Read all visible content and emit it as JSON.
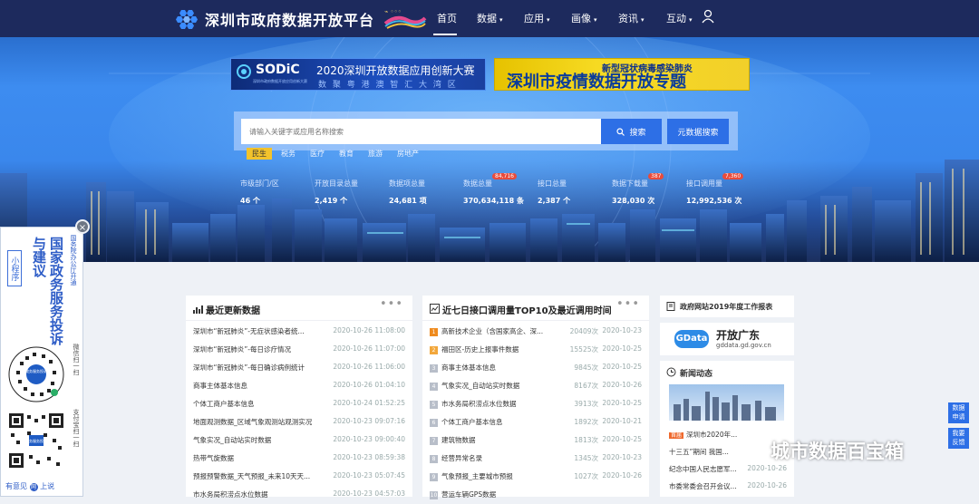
{
  "nav": {
    "site_title": "深圳市政府数据开放平台",
    "items": [
      {
        "label": "首页",
        "dropdown": false
      },
      {
        "label": "数据",
        "dropdown": true
      },
      {
        "label": "应用",
        "dropdown": true
      },
      {
        "label": "画像",
        "dropdown": true
      },
      {
        "label": "资讯",
        "dropdown": true
      },
      {
        "label": "互动",
        "dropdown": true
      }
    ],
    "caret": "▾",
    "icons": {
      "logo": "hexagon-logo-icon",
      "user": "user-icon",
      "award": "award-badge-icon"
    }
  },
  "banners": {
    "sodic": {
      "logo": "SODiC",
      "logo_sub": "深圳市政府数据开放应用创新大赛",
      "title": "2020深圳开放数据应用创新大赛",
      "subtitle": "数 聚 粤 港 澳  智 汇 大 湾 区"
    },
    "covid": {
      "small": "新型冠状病毒感染肺炎",
      "big": "深圳市疫情数据开放专题"
    }
  },
  "search": {
    "placeholder": "请输入关键字或应用名称搜索",
    "search_label": "搜索",
    "meta_label": "元数据搜索",
    "tags": [
      "民生",
      "税务",
      "医疗",
      "教育",
      "旅游",
      "房地产"
    ],
    "active_tag": "民生"
  },
  "stats": [
    {
      "label": "市级部门/区",
      "value": "46 个",
      "badge": ""
    },
    {
      "label": "开放目录总量",
      "value": "2,419 个",
      "badge": ""
    },
    {
      "label": "数据项总量",
      "value": "24,681 项",
      "badge": ""
    },
    {
      "label": "数据总量",
      "value": "370,634,118 条",
      "badge": "84,716"
    },
    {
      "label": "接口总量",
      "value": "2,387 个",
      "badge": ""
    },
    {
      "label": "数据下载量",
      "value": "328,030 次",
      "badge": "387"
    },
    {
      "label": "接口调用量",
      "value": "12,992,536 次",
      "badge": "7,360"
    }
  ],
  "float_panel": {
    "mini": "小程序",
    "title": "国家政务服务投诉与建议",
    "side": "国务院办公厅开通",
    "wechat": "微信扫一扫",
    "alipay": "支付宝扫一扫",
    "qr_center": "政务服务投诉",
    "bottom_a": "有意见",
    "bottom_b": "上说",
    "close": "×"
  },
  "latest": {
    "title": "最近更新数据",
    "more": "•••",
    "rows": [
      {
        "title": "深圳市“新冠肺炎”-无症状感染者统...",
        "date": "2020-10-26 11:08:00"
      },
      {
        "title": "深圳市“新冠肺炎”-每日诊疗情况",
        "date": "2020-10-26 11:07:00"
      },
      {
        "title": "深圳市“新冠肺炎”-每日确诊病例统计",
        "date": "2020-10-26 11:06:00"
      },
      {
        "title": "商事主体基本信息",
        "date": "2020-10-26 01:04:10"
      },
      {
        "title": "个体工商户基本信息",
        "date": "2020-10-24 01:52:25"
      },
      {
        "title": "地面观测数据_区域气象观测站观测实况",
        "date": "2020-10-23 09:07:16"
      },
      {
        "title": "气象实况_自动站实时数据",
        "date": "2020-10-23 09:00:40"
      },
      {
        "title": "热带气旋数据",
        "date": "2020-10-23 08:59:38"
      },
      {
        "title": "预报预警数据_天气预报_未来10天天...",
        "date": "2020-10-23 05:07:45"
      },
      {
        "title": "市水务局积涝点水位数据",
        "date": "2020-10-23 04:57:03"
      }
    ]
  },
  "top10": {
    "title": "近七日接口调用量TOP10及最近调用时间",
    "more": "•••",
    "rows": [
      {
        "rank": "1",
        "title": "高新技术企业（含国家高企、深...",
        "count": "20409次",
        "date": "2020-10-23",
        "color": "#ef8b1e"
      },
      {
        "rank": "2",
        "title": "福田区-历史上报事件数据",
        "count": "15525次",
        "date": "2020-10-25",
        "color": "#f2a73b"
      },
      {
        "rank": "3",
        "title": "商事主体基本信息",
        "count": "9845次",
        "date": "2020-10-25",
        "color": "#b8bec9"
      },
      {
        "rank": "4",
        "title": "气象实况_自动站实时数据",
        "count": "8167次",
        "date": "2020-10-26",
        "color": "#b8bec9"
      },
      {
        "rank": "5",
        "title": "市水务局积涝点水位数据",
        "count": "3913次",
        "date": "2020-10-25",
        "color": "#b8bec9"
      },
      {
        "rank": "6",
        "title": "个体工商户基本信息",
        "count": "1892次",
        "date": "2020-10-21",
        "color": "#b8bec9"
      },
      {
        "rank": "7",
        "title": "建筑物数据",
        "count": "1813次",
        "date": "2020-10-25",
        "color": "#b8bec9"
      },
      {
        "rank": "8",
        "title": "经营异常名录",
        "count": "1345次",
        "date": "2020-10-23",
        "color": "#b8bec9"
      },
      {
        "rank": "9",
        "title": "气象预报_主要城市预报",
        "count": "1027次",
        "date": "2020-10-26",
        "color": "#b8bec9"
      },
      {
        "rank": "10",
        "title": "营运车辆GPS数据",
        "count": "",
        "date": "",
        "color": "#b8bec9"
      }
    ]
  },
  "right": {
    "report": "政府网站2019年度工作报表",
    "gdata_logo": "GData",
    "gdata_title": "开放广东",
    "gdata_url": "gddata.gd.gov.cn",
    "news_title": "新闻动态",
    "news_more": "•••",
    "news_tag": "首届",
    "news_rows": [
      {
        "title": "深圳市2020年...",
        "date": ""
      },
      {
        "title": "十三五”期间 我国...",
        "date": ""
      },
      {
        "title": "纪念中国人民志愿军...",
        "date": "2020-10-26"
      },
      {
        "title": "市委常委会召开会议...",
        "date": "2020-10-26"
      }
    ]
  },
  "floating_buttons": {
    "help": "数据\n申请",
    "feedback": "我要\n反馈"
  },
  "watermark": "城市数据百宝箱",
  "colors": {
    "nav": "#1d2a5d",
    "accent": "#2d6fe6",
    "tag_active": "#f2c32c",
    "badge": "#e94b3b"
  }
}
